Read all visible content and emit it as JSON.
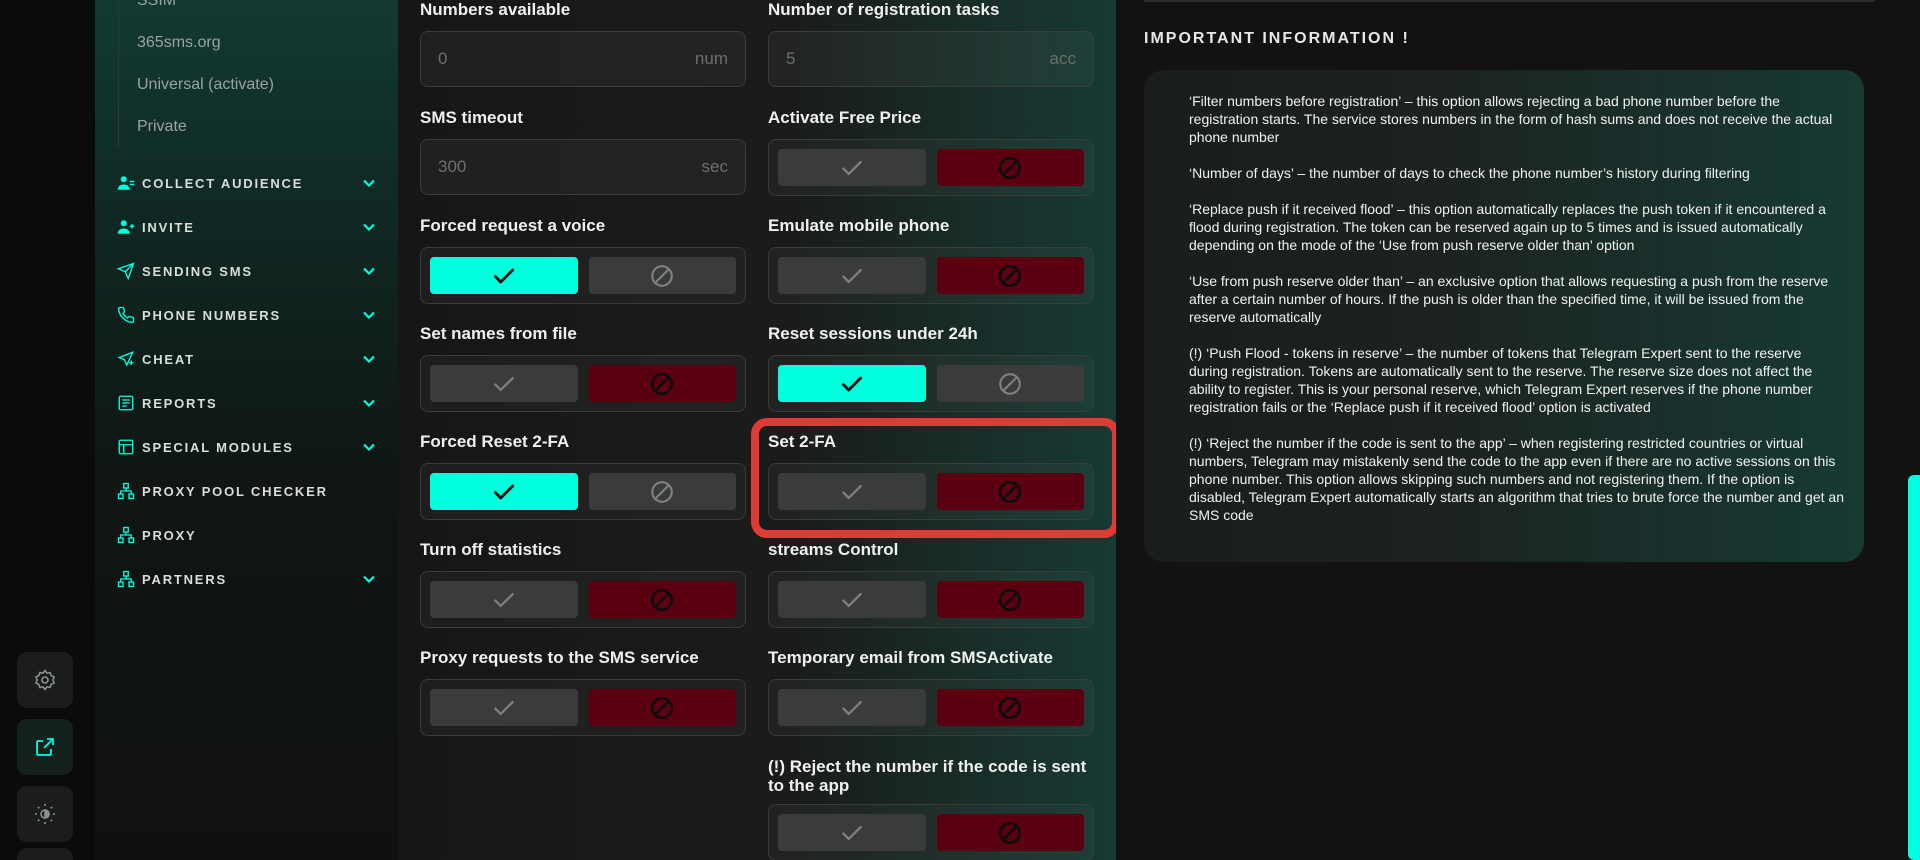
{
  "sidebar": {
    "sub_items": [
      "SSIM",
      "365sms.org",
      "Universal (activate)",
      "Private"
    ],
    "nav": [
      {
        "label": "COLLECT AUDIENCE",
        "icon": "users-icon",
        "expandable": true
      },
      {
        "label": "INVITE",
        "icon": "user-plus-icon",
        "expandable": true
      },
      {
        "label": "SENDING SMS",
        "icon": "send-icon",
        "expandable": true
      },
      {
        "label": "PHONE NUMBERS",
        "icon": "phone-icon",
        "expandable": true
      },
      {
        "label": "CHEAT",
        "icon": "send-plus-icon",
        "expandable": true
      },
      {
        "label": "REPORTS",
        "icon": "report-icon",
        "expandable": true
      },
      {
        "label": "SPECIAL MODULES",
        "icon": "modules-icon",
        "expandable": true
      },
      {
        "label": "PROXY POOL CHECKER",
        "icon": "network-icon",
        "expandable": false
      },
      {
        "label": "PROXY",
        "icon": "network-icon",
        "expandable": false
      },
      {
        "label": "PARTNERS",
        "icon": "network-icon",
        "expandable": true
      }
    ]
  },
  "rail": {
    "icons": [
      "settings-icon",
      "external-link-icon",
      "brightness-icon"
    ]
  },
  "colors": {
    "accent": "#00ffdd",
    "danger": "#5a0010",
    "highlight": "#e03a36"
  },
  "settings": {
    "numbers_available": {
      "title": "Numbers available",
      "placeholder": "0",
      "unit": "num"
    },
    "registration_tasks": {
      "title": "Number of registration tasks",
      "placeholder": "5",
      "unit": "acc"
    },
    "sms_timeout": {
      "title": "SMS timeout",
      "placeholder": "300",
      "unit": "sec"
    },
    "activate_free_price": {
      "title": "Activate Free Price",
      "enabled": false
    },
    "forced_request_voice": {
      "title": "Forced request a voice",
      "enabled": true
    },
    "emulate_mobile": {
      "title": "Emulate mobile phone",
      "enabled": false
    },
    "set_names_from_file": {
      "title": "Set names from file",
      "enabled": false
    },
    "reset_sessions": {
      "title": "Reset sessions under 24h",
      "enabled": true
    },
    "forced_reset_2fa": {
      "title": "Forced Reset 2-FA",
      "enabled": true
    },
    "set_2fa": {
      "title": "Set 2-FA",
      "enabled": false
    },
    "turn_off_statistics": {
      "title": "Turn off statistics",
      "enabled": false
    },
    "streams_control": {
      "title": "streams Control",
      "enabled": false
    },
    "proxy_requests": {
      "title": "Proxy requests to the SMS service",
      "enabled": false
    },
    "temporary_email": {
      "title": "Temporary email from SMSActivate",
      "enabled": false
    },
    "reject_number": {
      "title": "(!) Reject the number if the code is sent to the app",
      "enabled": false
    }
  },
  "info": {
    "heading": "IMPORTANT INFORMATION !",
    "paragraphs": [
      "‘Filter numbers before registration’ – this option allows rejecting a bad phone number before the registration starts. The service stores numbers in the form of hash sums and does not receive the actual phone number",
      "‘Number of days’ – the number of days to check the phone number’s history during filtering",
      "‘Replace push if it received flood’ – this option automatically replaces the push token if it encountered a flood during registration. The token can be reserved again up to 5 times and is issued automatically depending on the mode of the ‘Use from push reserve older than’ option",
      "‘Use from push reserve older than’ – an exclusive option that allows requesting a push from the reserve after a certain number of hours. If the push is older than the specified time, it will be issued from the reserve automatically",
      "(!) ‘Push Flood - tokens in reserve’ – the number of tokens that Telegram Expert sent to the reserve during registration. Tokens are automatically sent to the reserve. The reserve size does not affect the ability to register. This is your personal reserve, which Telegram Expert reserves if the phone number registration fails or the ‘Replace push if it received flood’ option is activated",
      "(!) ‘Reject the number if the code is sent to the app’ – when registering restricted countries or virtual numbers, Telegram may mistakenly send the code to the app even if there are no active sessions on this phone number. This option allows skipping such numbers and not registering them. If the option is disabled, Telegram Expert automatically starts an algorithm that tries to brute force the number and get an SMS code"
    ]
  }
}
